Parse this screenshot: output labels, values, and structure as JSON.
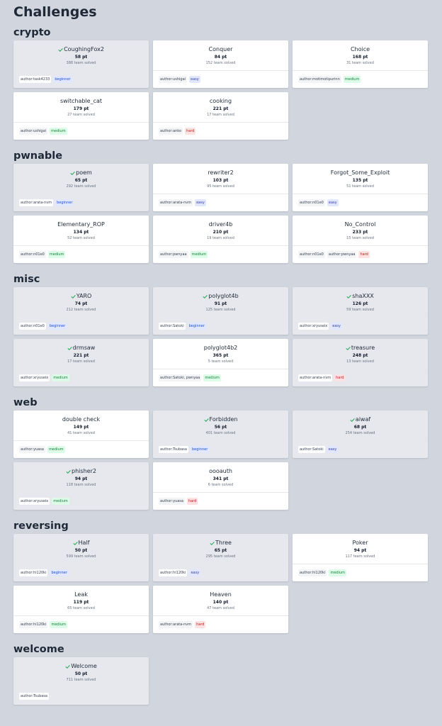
{
  "page_title": "Challenges",
  "categories": [
    {
      "name": "crypto",
      "challenges": [
        {
          "name": "CoughingFox2",
          "points": "58 pt",
          "solves": "388 team solved",
          "authors": [
            "author:task4233"
          ],
          "difficulty": "beginner",
          "solved": true
        },
        {
          "name": "Conquer",
          "points": "84 pt",
          "solves": "152 team solved",
          "authors": [
            "author:ushigai"
          ],
          "difficulty": "easy",
          "solved": false
        },
        {
          "name": "Choice",
          "points": "168 pt",
          "solves": "31 team solved",
          "authors": [
            "author:motimotipurinn"
          ],
          "difficulty": "medium",
          "solved": false
        },
        {
          "name": "switchable_cat",
          "points": "179 pt",
          "solves": "27 team solved",
          "authors": [
            "author:ushigai"
          ],
          "difficulty": "medium",
          "solved": false
        },
        {
          "name": "cooking",
          "points": "221 pt",
          "solves": "17 team solved",
          "authors": [
            "author:anko"
          ],
          "difficulty": "hard",
          "solved": false
        }
      ]
    },
    {
      "name": "pwnable",
      "challenges": [
        {
          "name": "poem",
          "points": "65 pt",
          "solves": "292 team solved",
          "authors": [
            "author:arata-nvm"
          ],
          "difficulty": "beginner",
          "solved": true
        },
        {
          "name": "rewriter2",
          "points": "103 pt",
          "solves": "95 team solved",
          "authors": [
            "author:arata-nvm"
          ],
          "difficulty": "easy",
          "solved": false
        },
        {
          "name": "Forgot_Some_Exploit",
          "points": "135 pt",
          "solves": "51 team solved",
          "authors": [
            "author:n01e0"
          ],
          "difficulty": "easy",
          "solved": false
        },
        {
          "name": "Elementary_ROP",
          "points": "134 pt",
          "solves": "52 team solved",
          "authors": [
            "author:n01e0"
          ],
          "difficulty": "medium",
          "solved": false
        },
        {
          "name": "driver4b",
          "points": "210 pt",
          "solves": "19 team solved",
          "authors": [
            "author:pwnyaa"
          ],
          "difficulty": "medium",
          "solved": false
        },
        {
          "name": "No_Control",
          "points": "233 pt",
          "solves": "15 team solved",
          "authors": [
            "author:n01e0",
            "author:pwnyaa"
          ],
          "difficulty": "hard",
          "solved": false
        }
      ]
    },
    {
      "name": "misc",
      "challenges": [
        {
          "name": "YARO",
          "points": "74 pt",
          "solves": "212 team solved",
          "authors": [
            "author:n01e0"
          ],
          "difficulty": "beginner",
          "solved": true
        },
        {
          "name": "polyglot4b",
          "points": "91 pt",
          "solves": "125 team solved",
          "authors": [
            "author:Satoki"
          ],
          "difficulty": "beginner",
          "solved": true
        },
        {
          "name": "shaXXX",
          "points": "126 pt",
          "solves": "59 team solved",
          "authors": [
            "author:xryuseix"
          ],
          "difficulty": "easy",
          "solved": true
        },
        {
          "name": "drmsaw",
          "points": "221 pt",
          "solves": "17 team solved",
          "authors": [
            "author:xryuseix"
          ],
          "difficulty": "medium",
          "solved": true
        },
        {
          "name": "polyglot4b2",
          "points": "365 pt",
          "solves": "5 team solved",
          "authors": [
            "author:Satoki, pwnyaa"
          ],
          "difficulty": "medium",
          "solved": false
        },
        {
          "name": "treasure",
          "points": "248 pt",
          "solves": "13 team solved",
          "authors": [
            "author:arata-nvm"
          ],
          "difficulty": "hard",
          "solved": true
        }
      ]
    },
    {
      "name": "web",
      "challenges": [
        {
          "name": "double check",
          "points": "149 pt",
          "solves": "41 team solved",
          "authors": [
            "author:yuasa"
          ],
          "difficulty": "medium",
          "solved": false
        },
        {
          "name": "Forbidden",
          "points": "56 pt",
          "solves": "401 team solved",
          "authors": [
            "author:Tsubasa"
          ],
          "difficulty": "beginner",
          "solved": true
        },
        {
          "name": "aiwaf",
          "points": "68 pt",
          "solves": "254 team solved",
          "authors": [
            "author:Satoki"
          ],
          "difficulty": "easy",
          "solved": true
        },
        {
          "name": "phisher2",
          "points": "94 pt",
          "solves": "118 team solved",
          "authors": [
            "author:xryuseix"
          ],
          "difficulty": "medium",
          "solved": true
        },
        {
          "name": "oooauth",
          "points": "341 pt",
          "solves": "6 team solved",
          "authors": [
            "author:yuasa"
          ],
          "difficulty": "hard",
          "solved": false
        }
      ]
    },
    {
      "name": "reversing",
      "challenges": [
        {
          "name": "Half",
          "points": "50 pt",
          "solves": "599 team solved",
          "authors": [
            "author:hi120ki"
          ],
          "difficulty": "beginner",
          "solved": true
        },
        {
          "name": "Three",
          "points": "65 pt",
          "solves": "295 team solved",
          "authors": [
            "author:hi120ki"
          ],
          "difficulty": "easy",
          "solved": true
        },
        {
          "name": "Poker",
          "points": "94 pt",
          "solves": "117 team solved",
          "authors": [
            "author:hi120ki"
          ],
          "difficulty": "medium",
          "solved": false
        },
        {
          "name": "Leak",
          "points": "119 pt",
          "solves": "65 team solved",
          "authors": [
            "author:hi120ki"
          ],
          "difficulty": "medium",
          "solved": false
        },
        {
          "name": "Heaven",
          "points": "140 pt",
          "solves": "47 team solved",
          "authors": [
            "author:arata-nvm"
          ],
          "difficulty": "hard",
          "solved": false
        }
      ]
    },
    {
      "name": "welcome",
      "challenges": [
        {
          "name": "Welcome",
          "points": "50 pt",
          "solves": "711 team solved",
          "authors": [
            "author:Tsubasa"
          ],
          "difficulty": "",
          "solved": true
        }
      ]
    }
  ]
}
